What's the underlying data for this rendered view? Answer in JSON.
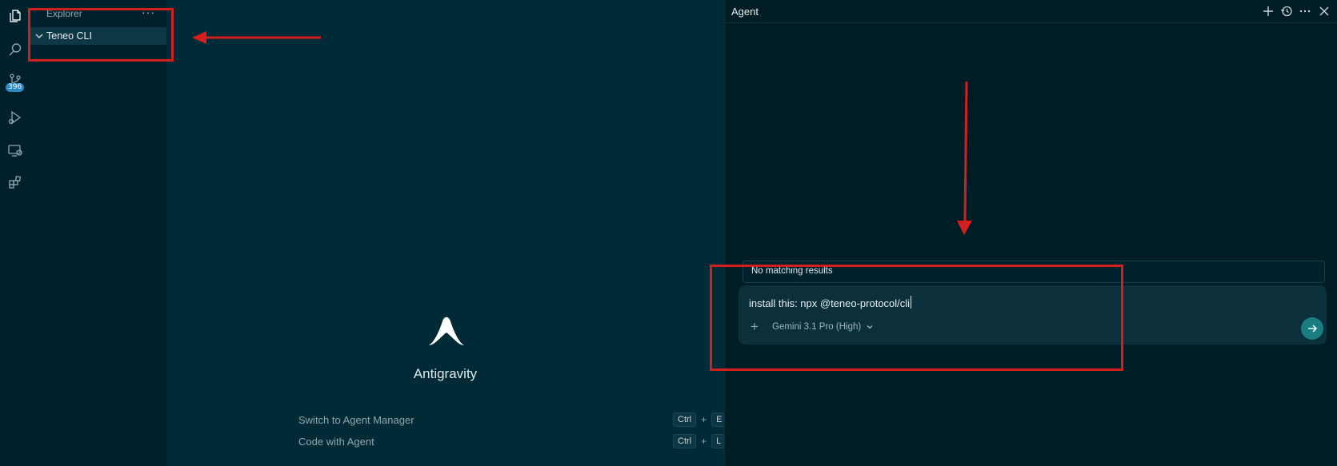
{
  "activity_bar": {
    "source_control_badge": "396"
  },
  "sidebar": {
    "title": "Explorer",
    "more_label": "···",
    "folder": "Teneo CLI"
  },
  "editor": {
    "app_name": "Antigravity",
    "shortcuts": [
      {
        "label": "Switch to Agent Manager",
        "mod": "Ctrl",
        "plus": "+",
        "key": "E"
      },
      {
        "label": "Code with Agent",
        "mod": "Ctrl",
        "plus": "+",
        "key": "L"
      }
    ]
  },
  "agent": {
    "title": "Agent",
    "no_results": "No matching results",
    "input_value": "install this: npx @teneo-protocol/cli",
    "add_label": "+",
    "model": "Gemini 3.1 Pro (High)"
  },
  "colors": {
    "annotation_red": "#d41f1f",
    "send_button": "#1a7d82",
    "badge": "#2a8cc4"
  }
}
